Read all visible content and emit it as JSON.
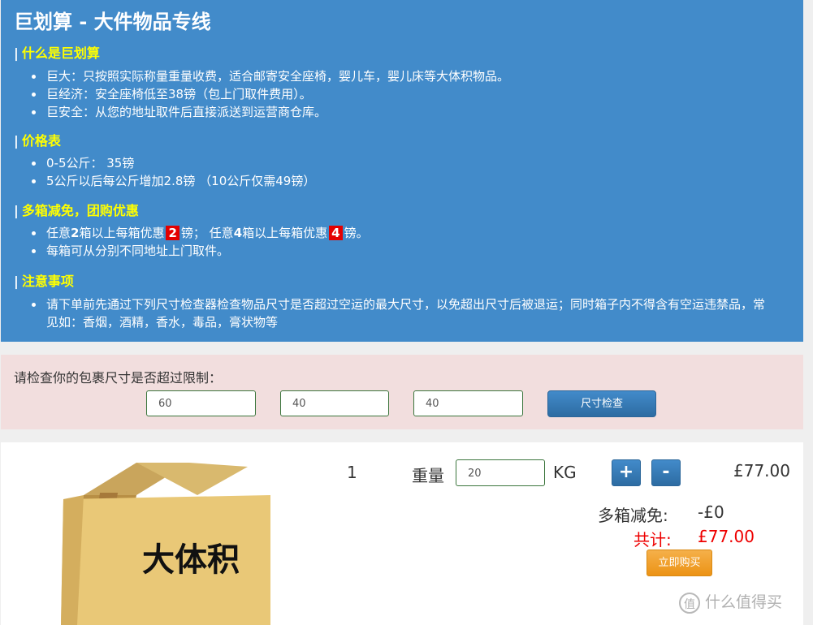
{
  "info": {
    "title": "巨划算 - 大件物品专线",
    "section1": {
      "heading": "什么是巨划算",
      "items": [
        "巨大：只按照实际称量重量收费，适合邮寄安全座椅，婴儿车，婴儿床等大体积物品。",
        "巨经济：安全座椅低至38镑（包上门取件费用）。",
        "巨安全：从您的地址取件后直接派送到运营商仓库。"
      ]
    },
    "section2": {
      "heading": "价格表",
      "items": [
        "0-5公斤： 35镑",
        "5公斤以后每公斤增加2.8镑 （10公斤仅需49镑）"
      ]
    },
    "section3": {
      "heading": "多箱减免，团购优惠",
      "item1_a": "任意",
      "item1_b": "2",
      "item1_c": "箱以上每箱优惠",
      "item1_d": "2",
      "item1_e": "镑； 任意",
      "item1_f": "4",
      "item1_g": "箱以上每箱优惠",
      "item1_h": "4",
      "item1_i": "镑。",
      "item2": "每箱可从分别不同地址上门取件。"
    },
    "section4": {
      "heading": "注意事项",
      "items": [
        "请下单前先通过下列尺寸检查器检查物品尺寸是否超过空运的最大尺寸，以免超出尺寸后被退运；同时箱子内不得含有空运违禁品，常见如：香烟，酒精，香水，毒品，膏状物等"
      ]
    }
  },
  "checker": {
    "label": "请检查你的包裹尺寸是否超过限制：",
    "length": "60",
    "width": "40",
    "height": "40",
    "button": "尺寸检查"
  },
  "product": {
    "image_text": "大体积",
    "quantity": "1",
    "weight_label": "重量",
    "weight_value": "20",
    "unit": "KG",
    "plus": "+",
    "minus": "-",
    "price": "£77.00",
    "discount_label": "多箱减免:",
    "discount_value": "-£0",
    "total_label": "共计:",
    "total_value": "£77.00",
    "buy_button": "立即购买"
  },
  "watermark": {
    "icon_char": "值",
    "text": "什么值得买"
  }
}
